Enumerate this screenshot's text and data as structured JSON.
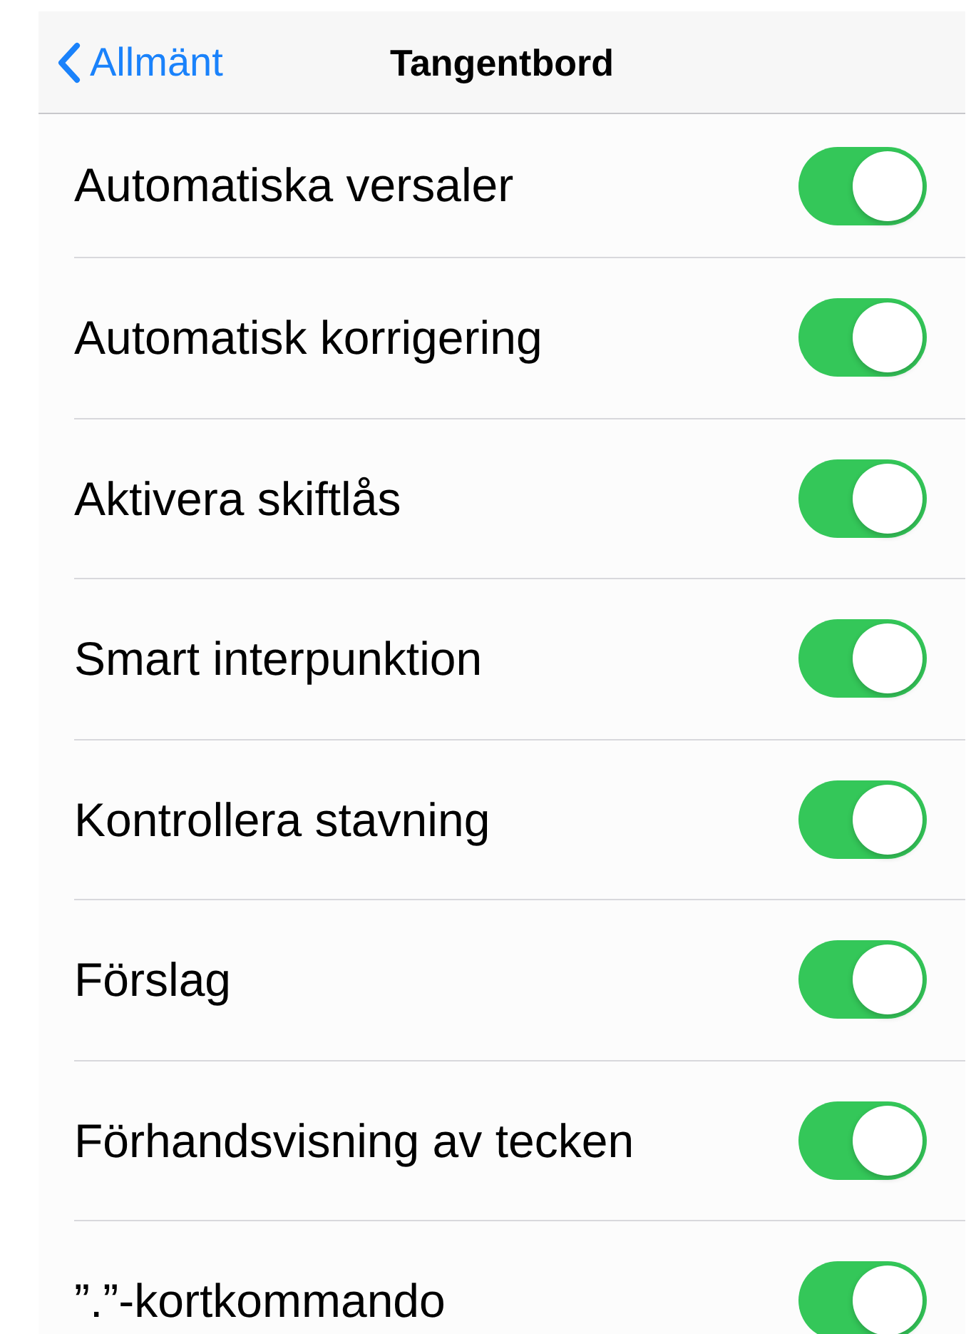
{
  "nav": {
    "back_label": "Allmänt",
    "title": "Tangentbord"
  },
  "settings": [
    {
      "label": "Automatiska versaler",
      "on": true
    },
    {
      "label": "Automatisk korrigering",
      "on": true
    },
    {
      "label": "Aktivera skiftlås",
      "on": true
    },
    {
      "label": "Smart interpunktion",
      "on": true
    },
    {
      "label": "Kontrollera stavning",
      "on": true
    },
    {
      "label": "Förslag",
      "on": true
    },
    {
      "label": "Förhandsvisning av tecken",
      "on": true
    },
    {
      "label": "”.”-kortkommando",
      "on": true
    }
  ]
}
